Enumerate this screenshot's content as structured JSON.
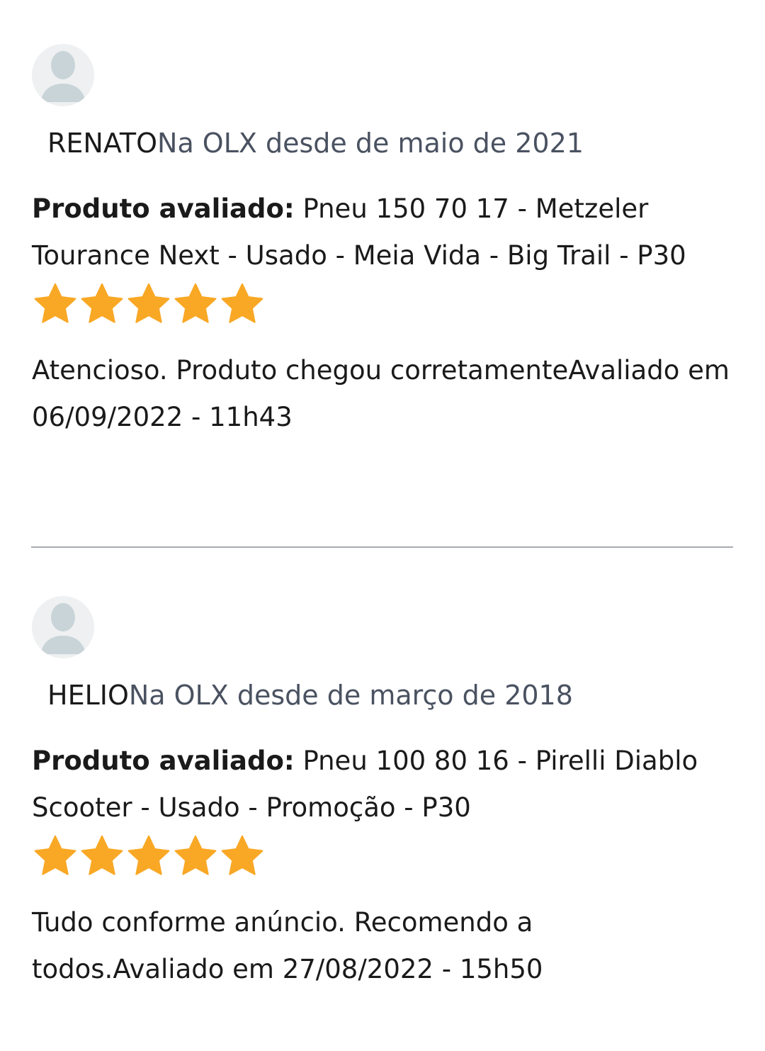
{
  "colors": {
    "star": "#F9A825",
    "muted_text": "#4a5261",
    "divider": "#a8abb0",
    "avatar_bg": "#eef0f1",
    "avatar_figure": "#c9d4d9"
  },
  "reviews": [
    {
      "user_name": "RENATO",
      "member_since": "Na OLX desde de maio de 2021",
      "product_label": "Produto avaliado:",
      "product_name": " Pneu 150 70 17 - Metzeler Tourance Next - Usado - Meia Vida - Big Trail - P30",
      "rating": 5,
      "comment": "Atencioso. Produto chegou corretamente",
      "date": "Avaliado em 06/09/2022 - 11h43",
      "avatar_icon": "user-avatar-icon",
      "star_icon": "star-icon"
    },
    {
      "user_name": "HELIO",
      "member_since": "Na OLX desde de março de 2018",
      "product_label": "Produto avaliado:",
      "product_name": " Pneu 100 80 16 - Pirelli Diablo Scooter - Usado - Promoção - P30",
      "rating": 5,
      "comment": "Tudo conforme anúncio. Recomendo a todos.",
      "date": "Avaliado em 27/08/2022 - 15h50",
      "avatar_icon": "user-avatar-icon",
      "star_icon": "star-icon"
    }
  ]
}
